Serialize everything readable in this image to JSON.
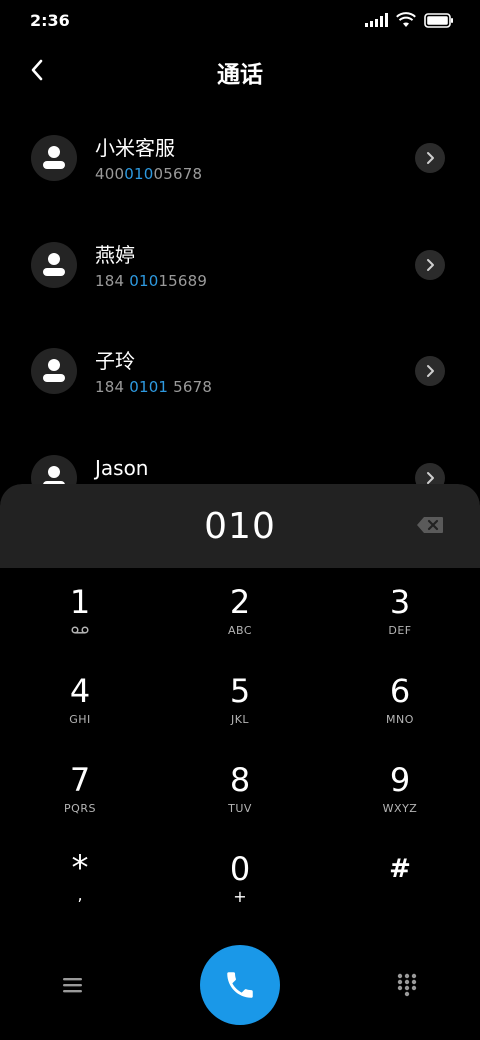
{
  "status_bar": {
    "time": "2:36",
    "icons": [
      "signal-icon",
      "wifi-icon",
      "battery-icon"
    ]
  },
  "header": {
    "title": "通话",
    "back_icon": "chevron-left-icon"
  },
  "contacts": [
    {
      "name": "小米客服",
      "number_parts": [
        "400",
        "010",
        "05678"
      ]
    },
    {
      "name": "燕婷",
      "number_parts": [
        "184 ",
        "010",
        "15689"
      ]
    },
    {
      "name": "子玲",
      "number_parts": [
        "184 ",
        "0101",
        " 5678"
      ]
    },
    {
      "name": "Jason",
      "number_parts": [
        "",
        "",
        ""
      ]
    }
  ],
  "dialer": {
    "dialed": "010",
    "backspace_icon": "backspace-icon"
  },
  "keypad": [
    {
      "digit": "1",
      "sub": ""
    },
    {
      "digit": "2",
      "sub": "ABC"
    },
    {
      "digit": "3",
      "sub": "DEF"
    },
    {
      "digit": "4",
      "sub": "GHI"
    },
    {
      "digit": "5",
      "sub": "JKL"
    },
    {
      "digit": "6",
      "sub": "MNO"
    },
    {
      "digit": "7",
      "sub": "PQRS"
    },
    {
      "digit": "8",
      "sub": "TUV"
    },
    {
      "digit": "9",
      "sub": "WXYZ"
    },
    {
      "digit": "*",
      "sub": ","
    },
    {
      "digit": "0",
      "sub": "+"
    },
    {
      "digit": "#",
      "sub": ""
    }
  ],
  "bottom_bar": {
    "menu_icon": "menu-icon",
    "call_icon": "phone-icon",
    "dialpad_icon": "dialpad-icon"
  },
  "colors": {
    "accent": "#1a98e8",
    "highlight": "#2e9ae0",
    "background": "#000000",
    "panel": "#222222"
  }
}
